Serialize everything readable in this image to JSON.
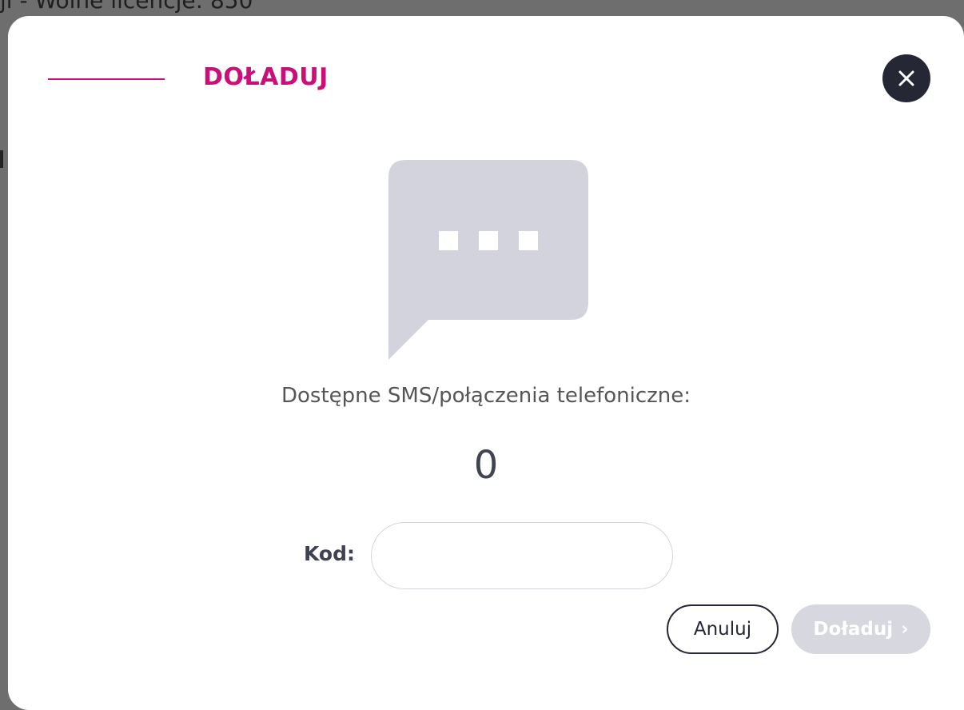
{
  "background": {
    "text": "ji - Wolne licencje: 850"
  },
  "modal": {
    "title": "DOŁADUJ",
    "accent_color": "#c80f7a",
    "close_icon": "close-icon",
    "chat_icon": "chat-bubble-icon",
    "available_label": "Dostępne SMS/połączenia telefoniczne:",
    "available_count": "0",
    "code_label": "Kod:",
    "code_value": "",
    "code_placeholder": "",
    "cancel_label": "Anuluj",
    "topup_label": "Doładuj",
    "topup_chevron": "›",
    "topup_disabled": true
  }
}
